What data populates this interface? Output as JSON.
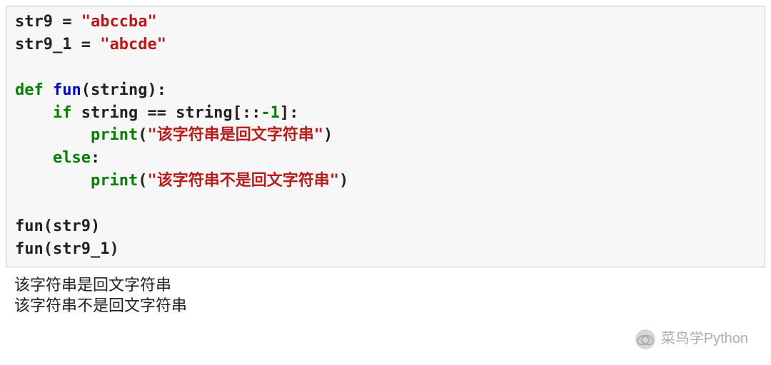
{
  "code": {
    "l1_var": "str9",
    "l1_eq": " = ",
    "l1_str": "\"abccba\"",
    "l2_var": "str9_1",
    "l2_eq": " = ",
    "l2_str": "\"abcde\"",
    "l3_def": "def",
    "l3_fn": "fun",
    "l3_args": "(string):",
    "l4_if": "if",
    "l4_cond": " string == string[::",
    "l4_neg": "-1",
    "l4_end": "]:",
    "l5_print": "print",
    "l5_open": "(",
    "l5_str": "\"该字符串是回文字符串\"",
    "l5_close": ")",
    "l6_else": "else",
    "l6_colon": ":",
    "l7_print": "print",
    "l7_open": "(",
    "l7_str": "\"该字符串不是回文字符串\"",
    "l7_close": ")",
    "l8": "fun(str9)",
    "l9": "fun(str9_1)"
  },
  "output": {
    "line1": "该字符串是回文字符串",
    "line2": "该字符串不是回文字符串"
  },
  "watermark": {
    "text": "菜鸟学Python"
  }
}
